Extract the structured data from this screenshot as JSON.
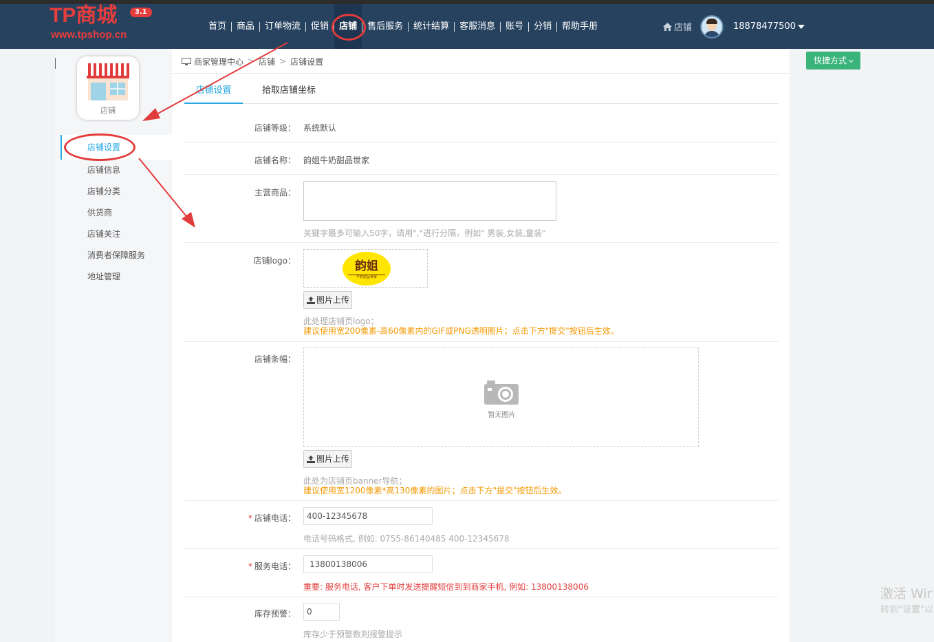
{
  "header": {
    "logo_text": "TP商城",
    "logo_version": "3.1",
    "logo_url": "www.tpshop.cn",
    "nav": [
      "首页",
      "商品",
      "订单物流",
      "促销",
      "店铺",
      "售后服务",
      "统计结算",
      "客服消息",
      "账号",
      "分销",
      "帮助手册"
    ],
    "active_nav": "店铺",
    "store_link": "店铺",
    "username": "18878477500"
  },
  "sidebar": {
    "app_label": "店铺",
    "items": [
      {
        "label": "店铺设置",
        "active": true
      },
      {
        "label": "店铺信息"
      },
      {
        "label": "店铺分类"
      },
      {
        "label": "供货商"
      },
      {
        "label": "店铺关注"
      },
      {
        "label": "消费者保障服务"
      },
      {
        "label": "地址管理"
      }
    ]
  },
  "breadcrumb": [
    "商家管理中心",
    "店铺",
    "店铺设置"
  ],
  "quick_button": "快捷方式",
  "tabs": [
    "店铺设置",
    "拾取店铺坐标"
  ],
  "form": {
    "level_label": "店铺等级：",
    "level_value": "系统默认",
    "name_label": "店铺名称：",
    "name_value": "韵姐牛奶甜品世家",
    "main_goods_label": "主营商品：",
    "main_goods_hint": "关键字最多可输入50字，请用\",\"进行分隔，例如\" 男装,女装,童装\"",
    "logo_label": "店铺logo：",
    "logo_image_text": "韵姐",
    "logo_image_subtext": "牛奶甜品世家",
    "upload_label": "图片上传",
    "logo_hint1": "此处理店铺页logo；",
    "logo_hint2": "建议使用宽200像素-高60像素内的GIF或PNG透明图片；点击下方\"提交\"按钮后生效。",
    "banner_label": "店铺条幅：",
    "no_image": "暂无图片",
    "banner_hint1": "此处为店铺页banner导航；",
    "banner_hint2": "建议使用宽1200像素*高130像素的图片；点击下方\"提交\"按钮后生效。",
    "phone_label": "店铺电话：",
    "phone_value": "400-12345678",
    "phone_hint": "电话号码格式, 例如: 0755-86140485 400-12345678",
    "service_label": "服务电话：",
    "service_value": "13800138006",
    "service_hint": "重要: 服务电话, 客户下单时发送提醒短信到到商家手机, 例如: 13800138006",
    "stock_label": "库存预警：",
    "stock_value": "0",
    "stock_hint": "库存少于预警数则报警提示"
  },
  "watermark": {
    "line1": "激活 Wir",
    "line2": "转到\"设置\"以"
  },
  "colors": {
    "header_bg": "#27425f",
    "accent": "#27a9e3",
    "quick_btn": "#3ab47b",
    "annotation": "#e23b3b",
    "logo_red": "#e63d3d"
  }
}
